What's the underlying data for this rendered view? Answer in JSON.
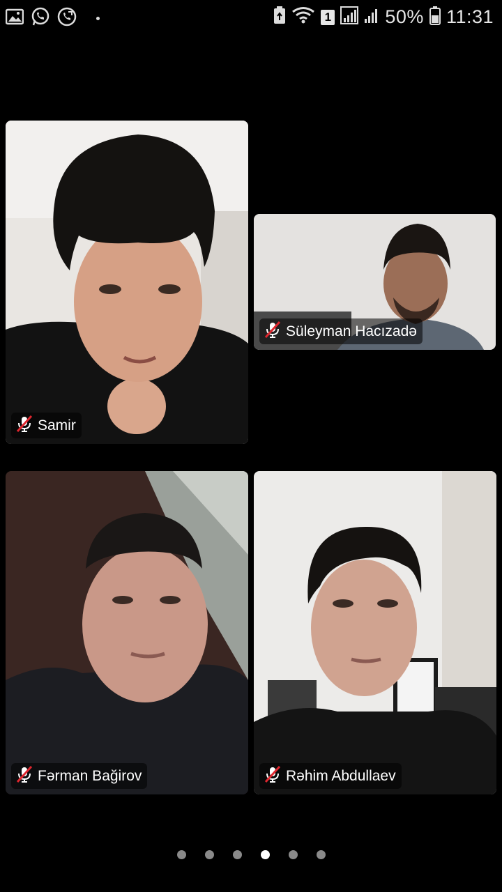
{
  "status_bar": {
    "left_icons": [
      "gallery-icon",
      "whatsapp-icon",
      "phone-call-icon",
      "notification-dot-icon"
    ],
    "right_icons": [
      "battery-saver-icon",
      "wifi-icon",
      "signal-icon"
    ],
    "sim_label": "1",
    "battery": "50%",
    "time": "11:31"
  },
  "participants": [
    {
      "name": "Samir",
      "muted": true,
      "mic_icon": "mic-off-icon"
    },
    {
      "name": "Süleyman Hacızadə",
      "muted": true,
      "mic_icon": "mic-off-icon"
    },
    {
      "name": "Fərman Bağirov",
      "muted": true,
      "mic_icon": "mic-off-icon"
    },
    {
      "name": "Rəhim Abdullaev",
      "muted": true,
      "mic_icon": "mic-off-icon"
    }
  ],
  "pagination": {
    "pages": 6,
    "current": 4
  },
  "colors": {
    "mute_red": "#e0262e",
    "background": "#000000",
    "inactive_dot": "#8a8a8a"
  }
}
